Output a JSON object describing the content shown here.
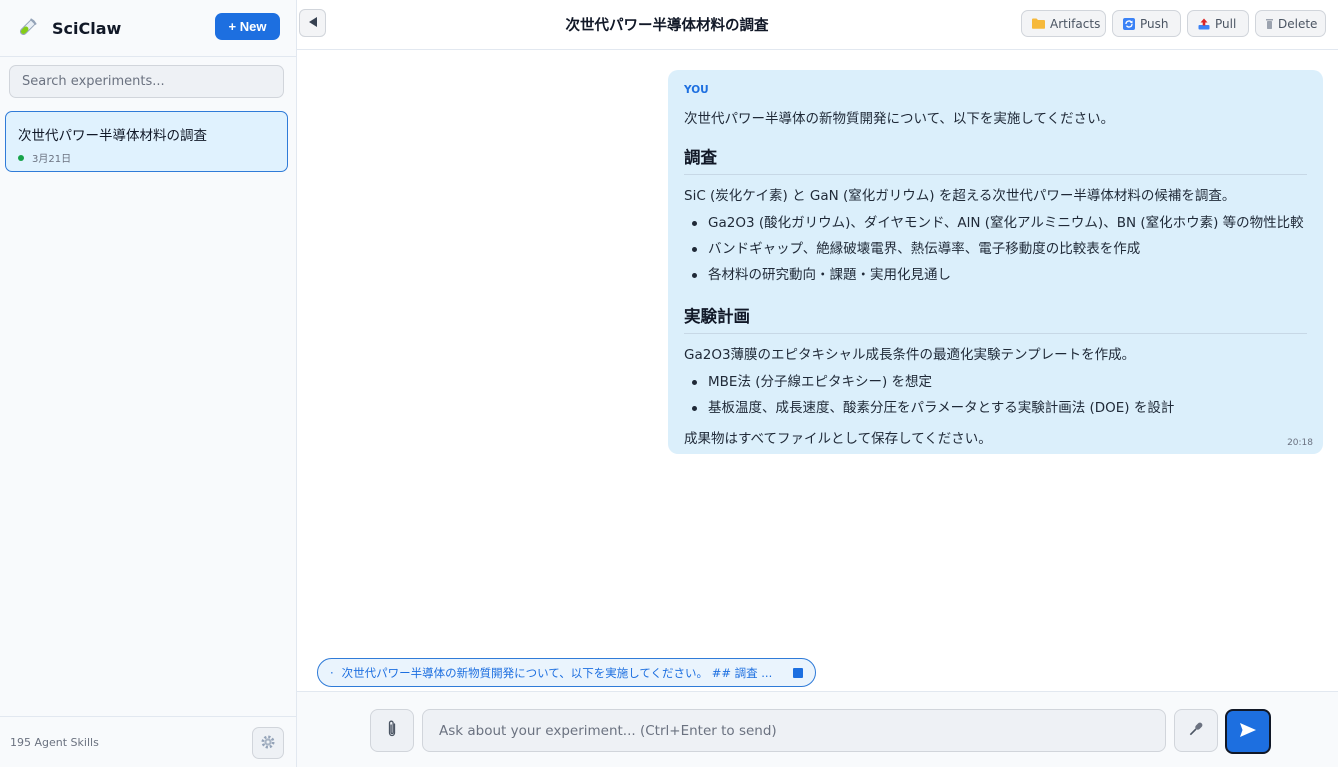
{
  "sidebar": {
    "app_name": "SciClaw",
    "new_button": "+ New",
    "search_placeholder": "Search experiments...",
    "experiments": [
      {
        "title": "次世代パワー半導体材料の調査",
        "date": "3月21日"
      }
    ],
    "skills_count": "195 Agent Skills"
  },
  "header": {
    "title": "次世代パワー半導体材料の調査",
    "artifacts_label": "Artifacts",
    "push_label": "Push",
    "pull_label": "Pull",
    "delete_label": "Delete"
  },
  "message": {
    "sender": "YOU",
    "intro": "次世代パワー半導体の新物質開発について、以下を実施してください。",
    "section1_heading": "調査",
    "section1_text": "SiC (炭化ケイ素) と GaN (窒化ガリウム) を超える次世代パワー半導体材料の候補を調査。",
    "section1_items": [
      "Ga2O3 (酸化ガリウム)、ダイヤモンド、AlN (窒化アルミニウム)、BN (窒化ホウ素) 等の物性比較",
      "バンドギャップ、絶縁破壊電界、熱伝導率、電子移動度の比較表を作成",
      "各材料の研究動向・課題・実用化見通し"
    ],
    "section2_heading": "実験計画",
    "section2_text": "Ga2O3薄膜のエピタキシャル成長条件の最適化実験テンプレートを作成。",
    "section2_items": [
      "MBE法 (分子線エピタキシー) を想定",
      "基板温度、成長速度、酸素分圧をパラメータとする実験計画法 (DOE) を設計"
    ],
    "closing": "成果物はすべてファイルとして保存してください。",
    "time": "20:18"
  },
  "pending": {
    "dot": "·",
    "text": "次世代パワー半導体の新物質開発について、以下を実施してください。 ## 調査 ..."
  },
  "composer": {
    "placeholder": "Ask about your experiment... (Ctrl+Enter to send)"
  },
  "icons": {
    "logo": "test-tube-icon",
    "collapse": "triangle-left-icon",
    "artifacts": "folder-icon",
    "push": "sync-icon",
    "pull": "upload-tray-icon",
    "delete": "trash-icon",
    "attach": "paperclip-icon",
    "mic": "microphone-icon",
    "send": "send-arrow-icon",
    "settings": "gear-icon"
  },
  "colors": {
    "accent": "#1d6fe0",
    "bubble": "#dbeffb",
    "selected_item": "#e0f2fe",
    "status_dot": "#16a34a"
  }
}
